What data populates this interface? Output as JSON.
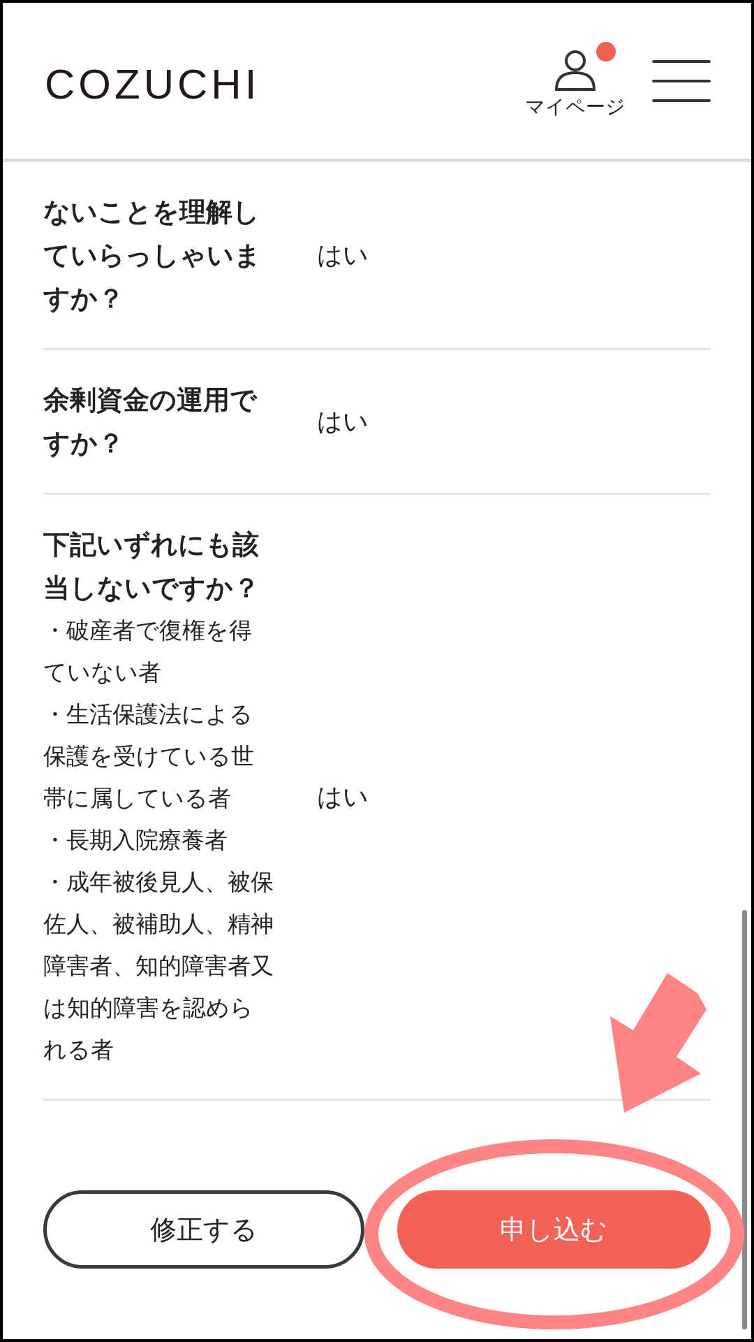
{
  "header": {
    "logo": "COZUCHI",
    "mypage_label": "マイページ",
    "has_notification": true
  },
  "rows": [
    {
      "question": "ないことを理解していらっしゃいますか？",
      "answer": "はい"
    },
    {
      "question": "余剰資金の運用ですか？",
      "answer": "はい"
    },
    {
      "question": "下記いずれにも該当しないですか？",
      "notes": [
        "・破産者で復権を得ていない者",
        "・生活保護法による保護を受けている世帯に属している者",
        "・長期入院療養者",
        "・成年被後見人、被保佐人、被補助人、精神障害者、知的障害者又は知的障害を認められる者"
      ],
      "answer": "はい"
    }
  ],
  "buttons": [
    {
      "label": "修正する",
      "kind": "secondary"
    },
    {
      "label": "申し込む",
      "kind": "primary"
    }
  ]
}
